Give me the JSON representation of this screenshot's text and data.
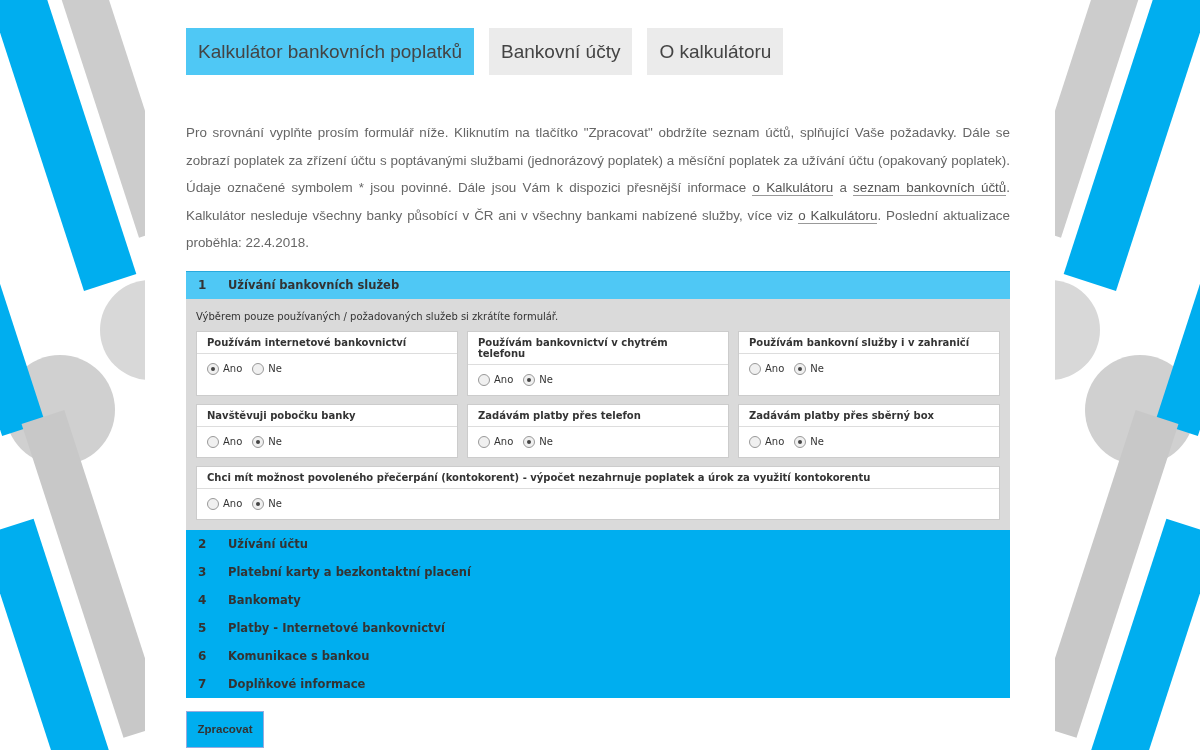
{
  "tabs": [
    {
      "label": "Kalkulátor bankovních poplatků",
      "selected": true
    },
    {
      "label": "Bankovní účty",
      "selected": false
    },
    {
      "label": "O kalkulátoru",
      "selected": false
    }
  ],
  "intro": [
    {
      "kind": "text",
      "text": "Pro srovnání vyplňte prosím formulář níže. Kliknutím na tlačítko \"Zpracovat\" obdržíte seznam účtů, splňující Vaše požadavky. Dále se zobrazí poplatek za zřízení účtu s poptávanými službami (jednorázový poplatek) a měsíční poplatek za užívání účtu (opakovaný poplatek). Údaje označené symbolem * jsou povinné. Dále jsou Vám k dispozici přesnější informace "
    },
    {
      "kind": "link",
      "text": "o Kalkulátoru"
    },
    {
      "kind": "text",
      "text": " a "
    },
    {
      "kind": "link",
      "text": "seznam bankovních účtů"
    },
    {
      "kind": "text",
      "text": ". Kalkulátor nesleduje všechny banky působící v ČR ani v všechny bankami nabízené služby, více viz "
    },
    {
      "kind": "link",
      "text": "o Kalkulátoru"
    },
    {
      "kind": "text",
      "text": ". Poslední aktualizace proběhla: 22.4.2018."
    }
  ],
  "sections": [
    {
      "number": "1",
      "title": "Užívání bankovních služeb",
      "expanded": true,
      "hint": "Výběrem pouze používaných / požadovaných služeb si zkrátíte formulář.",
      "questions": [
        {
          "kind": "normal",
          "label": "Používám internetové bankovnictví",
          "options": [
            {
              "label": "Ano",
              "selected": true
            },
            {
              "label": "Ne",
              "selected": false
            }
          ]
        },
        {
          "kind": "normal",
          "label": "Používám bankovnictví v chytrém telefonu",
          "options": [
            {
              "label": "Ano",
              "selected": false
            },
            {
              "label": "Ne",
              "selected": true
            }
          ]
        },
        {
          "kind": "normal",
          "label": "Používám bankovní služby i v zahraničí",
          "options": [
            {
              "label": "Ano",
              "selected": false
            },
            {
              "label": "Ne",
              "selected": true
            }
          ]
        },
        {
          "kind": "normal",
          "label": "Navštěvuji pobočku banky",
          "options": [
            {
              "label": "Ano",
              "selected": false
            },
            {
              "label": "Ne",
              "selected": true
            }
          ]
        },
        {
          "kind": "normal",
          "label": "Zadávám platby přes telefon",
          "options": [
            {
              "label": "Ano",
              "selected": false
            },
            {
              "label": "Ne",
              "selected": true
            }
          ]
        },
        {
          "kind": "normal",
          "label": "Zadávám platby přes sběrný box",
          "options": [
            {
              "label": "Ano",
              "selected": false
            },
            {
              "label": "Ne",
              "selected": true
            }
          ]
        },
        {
          "kind": "wide",
          "label": "Chci mít možnost povoleného přečerpání (kontokorent) - výpočet nezahrnuje poplatek a úrok za využití kontokorentu",
          "options": [
            {
              "label": "Ano",
              "selected": false
            },
            {
              "label": "Ne",
              "selected": true
            }
          ]
        }
      ]
    },
    {
      "number": "2",
      "title": "Užívání účtu",
      "expanded": false
    },
    {
      "number": "3",
      "title": "Platební karty a bezkontaktní placení",
      "expanded": false
    },
    {
      "number": "4",
      "title": "Bankomaty",
      "expanded": false
    },
    {
      "number": "5",
      "title": "Platby - Internetové bankovnictví",
      "expanded": false
    },
    {
      "number": "6",
      "title": "Komunikace s bankou",
      "expanded": false
    },
    {
      "number": "7",
      "title": "Doplňkové informace",
      "expanded": false
    }
  ],
  "submit": "Zpracovat"
}
